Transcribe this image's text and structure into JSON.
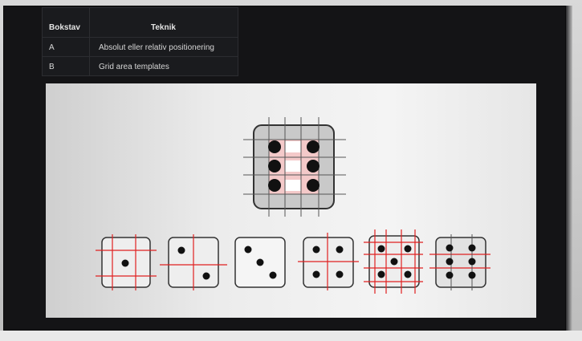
{
  "table": {
    "headers": [
      "Bokstav",
      "Teknik"
    ],
    "rows": [
      [
        "A",
        "Absolut eller relativ positionering"
      ],
      [
        "B",
        "Grid area templates"
      ]
    ]
  },
  "slide": {
    "big_die_value": 6,
    "small_dice_values": [
      1,
      2,
      3,
      4,
      5,
      6
    ]
  },
  "colors": {
    "monitor_bg": "#141416",
    "table_bg": "#1a1b1e",
    "slide_bg": "#ededed",
    "grid_line_red": "#e02020",
    "pip": "#111111",
    "grid_cell_pink": "#f4c9c9"
  }
}
